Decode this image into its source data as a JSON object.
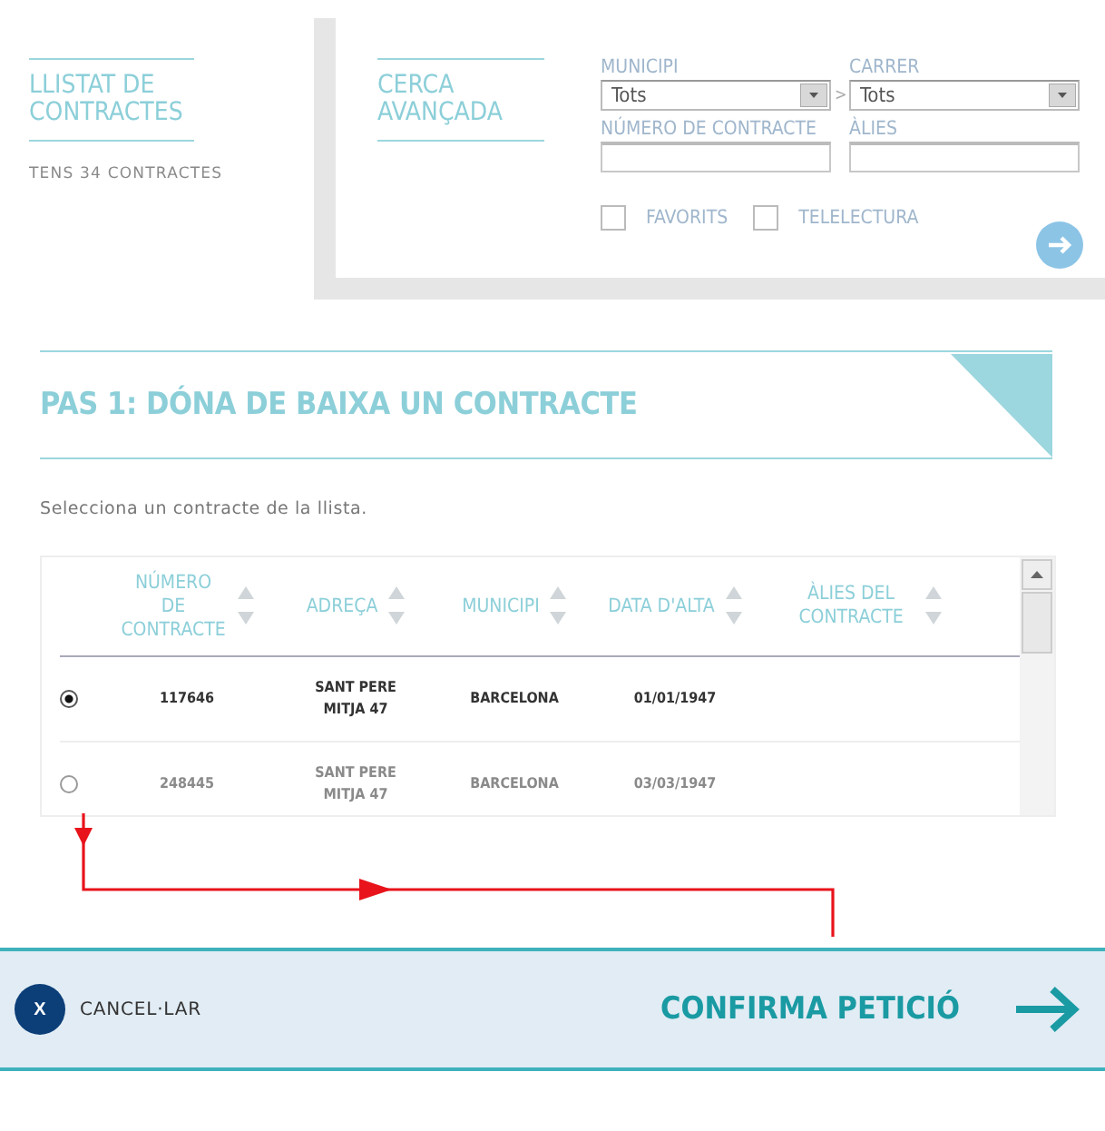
{
  "contracts_list": {
    "title": "LLISTAT DE CONTRACTES",
    "count": "TENS 34 CONTRACTES"
  },
  "advanced_search": {
    "title": "CERCA AVANÇADA",
    "separator": ">",
    "fields": [
      {
        "kind": "select",
        "label": "MUNICIPI",
        "value": "Tots"
      },
      {
        "kind": "select",
        "label": "CARRER",
        "value": "Tots"
      },
      {
        "kind": "text",
        "label": "NÚMERO DE CONTRACTE"
      },
      {
        "kind": "text",
        "label": "ÀLIES"
      }
    ],
    "checkboxes": [
      {
        "label": "FAVORITS",
        "checked": false
      },
      {
        "label": "TELELECTURA",
        "checked": false
      }
    ]
  },
  "step": {
    "title": "PAS 1: DÓNA DE BAIXA UN CONTRACTE",
    "instruction": "Selecciona un contracte de la llista."
  },
  "table": {
    "columns": [
      "NÚMERO DE CONTRACTE",
      "ADREÇA",
      "MUNICIPI",
      "DATA D'ALTA",
      "ÀLIES DEL CONTRACTE"
    ],
    "rows": [
      {
        "selected": true,
        "cells": [
          "117646",
          "SANT PERE MITJA 47",
          "BARCELONA",
          "01/01/1947"
        ]
      },
      {
        "selected": false,
        "cells": [
          "248445",
          "SANT PERE MITJA 47",
          "BARCELONA",
          "03/03/1947"
        ]
      }
    ]
  },
  "footer": {
    "cancel_icon": "X",
    "cancel": "CANCEL·LAR",
    "confirm": "CONFIRMA PETICIÓ"
  }
}
